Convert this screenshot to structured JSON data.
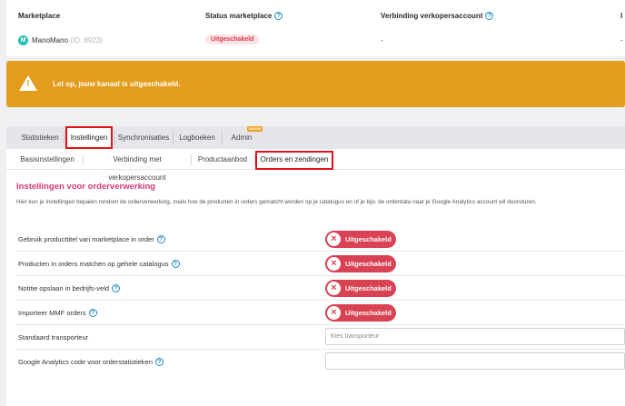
{
  "table": {
    "headers": [
      "Marketplace",
      "Status marketplace",
      "Verbinding verkopersaccount",
      "I"
    ],
    "row": {
      "logo_letter": "M",
      "name": "ManoMano",
      "id": "(ID: 8923)",
      "status": "Uitgeschakeld",
      "connection": "-",
      "extra": "-"
    }
  },
  "warning": {
    "icon": "warning-triangle-icon",
    "text": "Let op, jouw kanaal is uitgeschakeld."
  },
  "tabs": [
    {
      "label": "Statistieken"
    },
    {
      "label": "Instellingen",
      "active": true
    },
    {
      "label": "Synchronisaties"
    },
    {
      "label": "Logboeken"
    },
    {
      "label": "Admin",
      "badge": "NIEUW"
    }
  ],
  "subtabs": [
    {
      "label": "Basisinstellingen"
    },
    {
      "label": "Verbinding met verkopersaccount"
    },
    {
      "label": "Productaanbod"
    },
    {
      "label": "Orders en zendingen",
      "active": true
    }
  ],
  "section": {
    "title": "Instellingen voor orderverwerking",
    "description": "Hier kun je instellingen bepalen rondom de orderverwerking, zoals hoe de producten in orders gematcht worden op je catalogus en of je bijv. de orderdata naar je Google Analytics account wil doorsturen."
  },
  "settings": [
    {
      "label": "Gebruik producttitel van marketplace in order",
      "toggle": "Uitgeschakeld"
    },
    {
      "label": "Producten in orders matchen op gehele catalogus",
      "toggle": "Uitgeschakeld"
    },
    {
      "label": "Notitie opslaan in bedrijfs-veld",
      "toggle": "Uitgeschakeld"
    },
    {
      "label": "Importeer MMF orders",
      "toggle": "Uitgeschakeld"
    },
    {
      "label": "Standaard transporteur",
      "placeholder": "Kies transporteur"
    },
    {
      "label": "Google Analytics code voor orderstatistieken",
      "placeholder": ""
    }
  ],
  "colors": {
    "accent_pink": "#d43a7a",
    "warning_orange": "#e39c1c",
    "toggle_off_red": "#d94253",
    "highlight_red": "#e3111a"
  }
}
